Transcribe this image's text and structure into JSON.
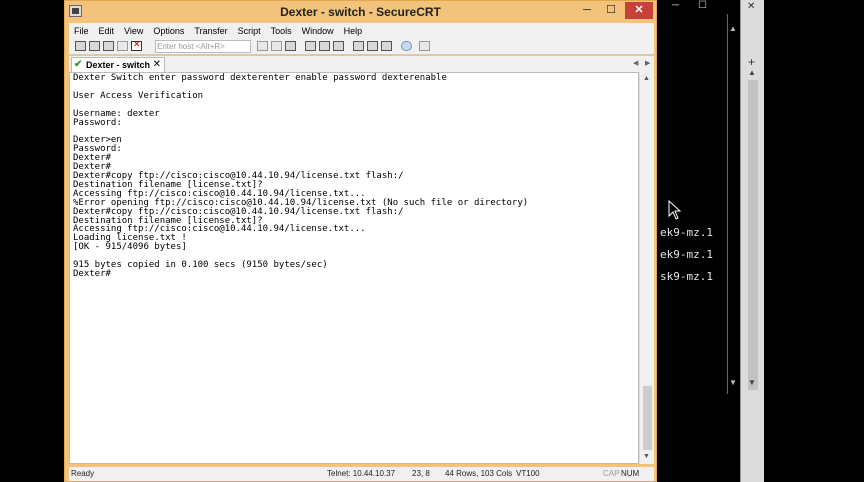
{
  "window": {
    "title": "Dexter - switch - SecureCRT",
    "minimize": "─",
    "maximize": "☐",
    "close": "✕"
  },
  "menu": [
    "File",
    "Edit",
    "View",
    "Options",
    "Transfer",
    "Script",
    "Tools",
    "Window",
    "Help"
  ],
  "toolbar": {
    "host_placeholder": "Enter host <Alt+R>"
  },
  "tab": {
    "label": "Dexter - switch",
    "close": "✕",
    "nav_prev": "◀",
    "nav_next": "▶"
  },
  "terminal_lines": [
    "Dexter Switch enter password dexterenter enable password dexterenable",
    "",
    "User Access Verification",
    "",
    "Username: dexter",
    "Password:",
    "",
    "Dexter>en",
    "Password:",
    "Dexter#",
    "Dexter#",
    "Dexter#copy ftp://cisco:cisco@10.44.10.94/license.txt flash:/",
    "Destination filename [license.txt]?",
    "Accessing ftp://cisco:cisco@10.44.10.94/license.txt...",
    "%Error opening ftp://cisco:cisco@10.44.10.94/license.txt (No such file or directory)",
    "Dexter#copy ftp://cisco:cisco@10.44.10.94/license.txt flash:/",
    "Destination filename [license.txt]?",
    "Accessing ftp://cisco:cisco@10.44.10.94/license.txt...",
    "Loading license.txt !",
    "[OK - 915/4096 bytes]",
    "",
    "915 bytes copied in 0.100 secs (9150 bytes/sec)",
    "Dexter#"
  ],
  "status": {
    "ready": "Ready",
    "connection": "Telnet: 10.44.10.37",
    "cursor_pos": "23,  8",
    "size": "44 Rows, 103 Cols",
    "emulation": "VT100",
    "caps": "CAP",
    "num": "NUM"
  },
  "right_terminal": {
    "lines": [
      "ek9-mz.1",
      "ek9-mz.1",
      "sk9-mz.1"
    ],
    "plus": "+",
    "close": "✕",
    "min": "─",
    "max": "☐"
  }
}
